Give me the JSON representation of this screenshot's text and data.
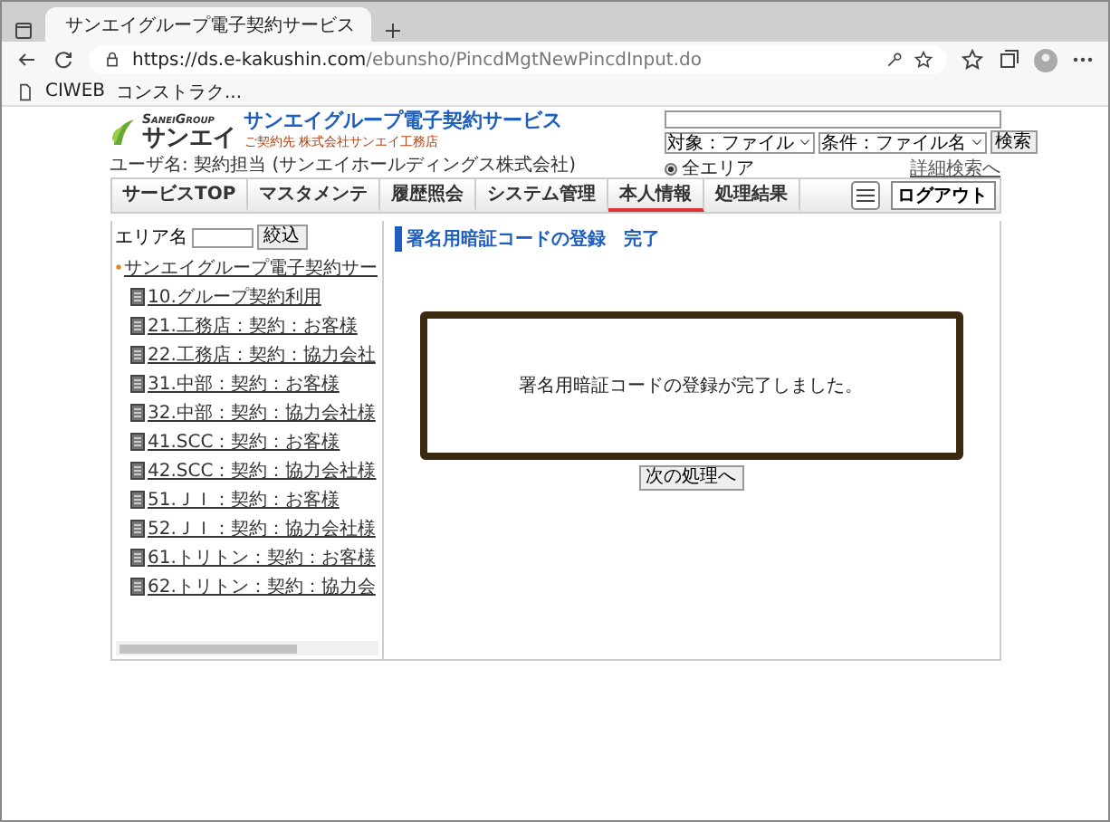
{
  "browser": {
    "tab_title": "サンエイグループ電子契約サービス",
    "url_host": "https://ds.e-kakushin.com",
    "url_path": "/ebunsho/PincdMgtNewPincdInput.do",
    "bookmarks": [
      "CIWEB",
      "コンストラク..."
    ]
  },
  "header": {
    "logo_group": "SaneiGroup",
    "logo_name": "サンエイ",
    "service_title": "サンエイグループ電子契約サービス",
    "contractor": "ご契約先 株式会社サンエイ工務店",
    "user": "ユーザ名: 契約担当 (サンエイホールディングス株式会社)"
  },
  "search": {
    "target": "対象：ファイル",
    "condition": "条件：ファイル名",
    "button": "検索",
    "scope": {
      "label": "全エリア",
      "selected": true
    },
    "advanced_link": "詳細検索へ"
  },
  "nav": {
    "tabs": [
      {
        "label": "サービスTOP",
        "selected": false
      },
      {
        "label": "マスタメンテ",
        "selected": false
      },
      {
        "label": "履歴照会",
        "selected": false
      },
      {
        "label": "システム管理",
        "selected": false
      },
      {
        "label": "本人情報",
        "selected": true
      },
      {
        "label": "処理結果",
        "selected": false
      }
    ],
    "logout": "ログアウト"
  },
  "sidebar": {
    "filter_label": "エリア名",
    "filter_button": "絞込",
    "root": "サンエイグループ電子契約サー",
    "items": [
      "10.グループ契約利用",
      "21.工務店：契約：お客様",
      "22.工務店：契約：協力会社",
      "31.中部：契約：お客様",
      "32.中部：契約：協力会社様",
      "41.SCC：契約：お客様",
      "42.SCC：契約：協力会社様",
      "51.ＪＩ：契約：お客様",
      "52.ＪＩ：契約：協力会社様",
      "61.トリトン：契約：お客様",
      "62.トリトン：契約：協力会"
    ]
  },
  "main": {
    "title": "署名用暗証コードの登録　完了",
    "message": "署名用暗証コードの登録が完了しました。",
    "next_button": "次の処理へ"
  }
}
